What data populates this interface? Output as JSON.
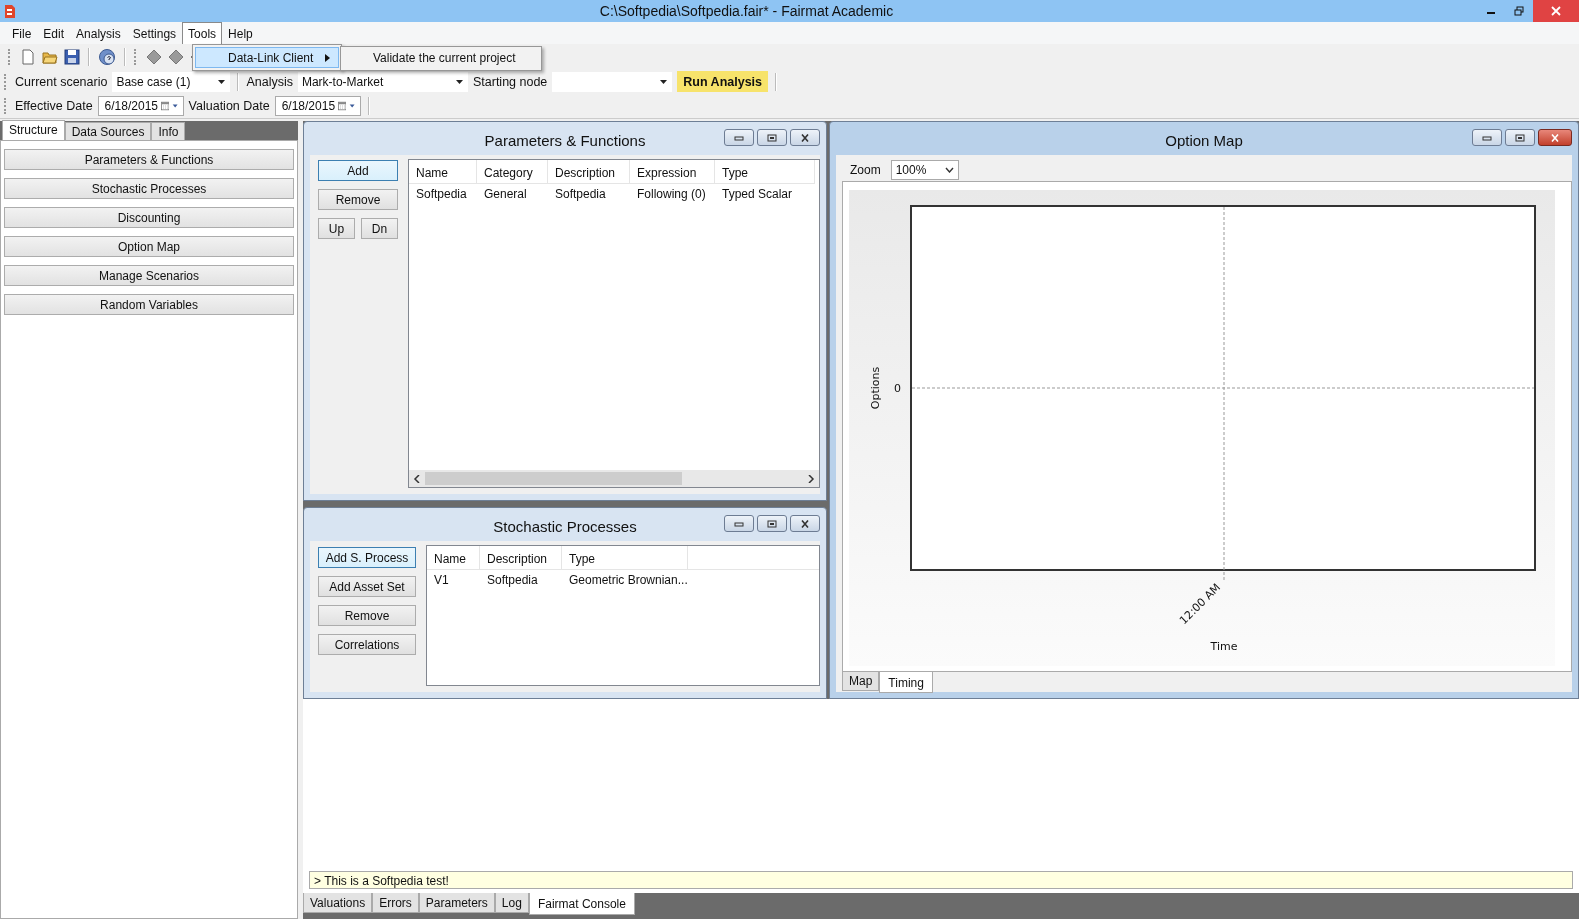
{
  "window": {
    "title": "C:\\Softpedia\\Softpedia.fair* - Fairmat Academic"
  },
  "menu": [
    {
      "label": "File",
      "selected": false
    },
    {
      "label": "Edit",
      "selected": false
    },
    {
      "label": "Analysis",
      "selected": false
    },
    {
      "label": "Settings",
      "selected": false
    },
    {
      "label": "Tools",
      "selected": true
    },
    {
      "label": "Help",
      "selected": false
    }
  ],
  "tools_menu": {
    "items": [
      {
        "label": "Data-Link Client",
        "has_submenu": true,
        "selected": true
      }
    ]
  },
  "submenu": {
    "items": [
      {
        "label": "Validate the current project",
        "selected": false
      }
    ]
  },
  "scenario_bar": {
    "current_scenario_label": "Current scenario",
    "current_scenario": "Base case (1)",
    "analysis_label": "Analysis",
    "analysis": "Mark-to-Market",
    "starting_node_label": "Starting node",
    "run_button": "Run Analysis"
  },
  "date_bar": {
    "effective_label": "Effective Date",
    "effective_date": "6/18/2015",
    "valuation_label": "Valuation Date",
    "valuation_date": "6/18/2015"
  },
  "sidebar": {
    "tabs": [
      {
        "label": "Structure",
        "selected": true
      },
      {
        "label": "Data Sources",
        "selected": false
      },
      {
        "label": "Info",
        "selected": false
      }
    ],
    "items": [
      "Parameters & Functions",
      "Stochastic Processes",
      "Discounting",
      "Option Map",
      "Manage Scenarios",
      "Random Variables"
    ]
  },
  "parameters_window": {
    "title": "Parameters & Functions",
    "active": false,
    "buttons": [
      {
        "label": "Add",
        "focused": true
      },
      {
        "label": "Remove",
        "focused": false
      },
      {
        "label": "Up",
        "focused": false
      },
      {
        "label": "Dn",
        "focused": false
      }
    ],
    "columns": [
      "Name",
      "Category",
      "Description",
      "Expression",
      "Type"
    ],
    "rows": [
      [
        "Softpedia",
        "General",
        "Softpedia",
        "Following (0)",
        "Typed Scalar"
      ]
    ]
  },
  "stochastic_window": {
    "title": "Stochastic Processes",
    "active": false,
    "buttons": [
      {
        "label": "Add S. Process",
        "focused": true
      },
      {
        "label": "Add Asset Set",
        "focused": false
      },
      {
        "label": "Remove",
        "focused": false
      },
      {
        "label": "Correlations",
        "focused": false
      }
    ],
    "columns": [
      "Name",
      "Description",
      "Type"
    ],
    "rows": [
      [
        "V1",
        "Softpedia",
        "Geometric Brownian..."
      ]
    ]
  },
  "option_map": {
    "title": "Option Map",
    "active": true,
    "zoom_label": "Zoom",
    "zoom": "100%",
    "plot": {
      "ylabel": "Options",
      "ytick": "0",
      "xtick": "12:00 AM",
      "xlabel": "Time"
    },
    "tabs": [
      {
        "label": "Map",
        "selected": false
      },
      {
        "label": "Timing",
        "selected": true
      }
    ]
  },
  "console": {
    "line": "> This is a Softpedia test!",
    "tabs": [
      {
        "label": "Valuations",
        "selected": false
      },
      {
        "label": "Errors",
        "selected": false
      },
      {
        "label": "Parameters",
        "selected": false
      },
      {
        "label": "Log",
        "selected": false
      },
      {
        "label": "Fairmat Console",
        "selected": true
      }
    ]
  }
}
